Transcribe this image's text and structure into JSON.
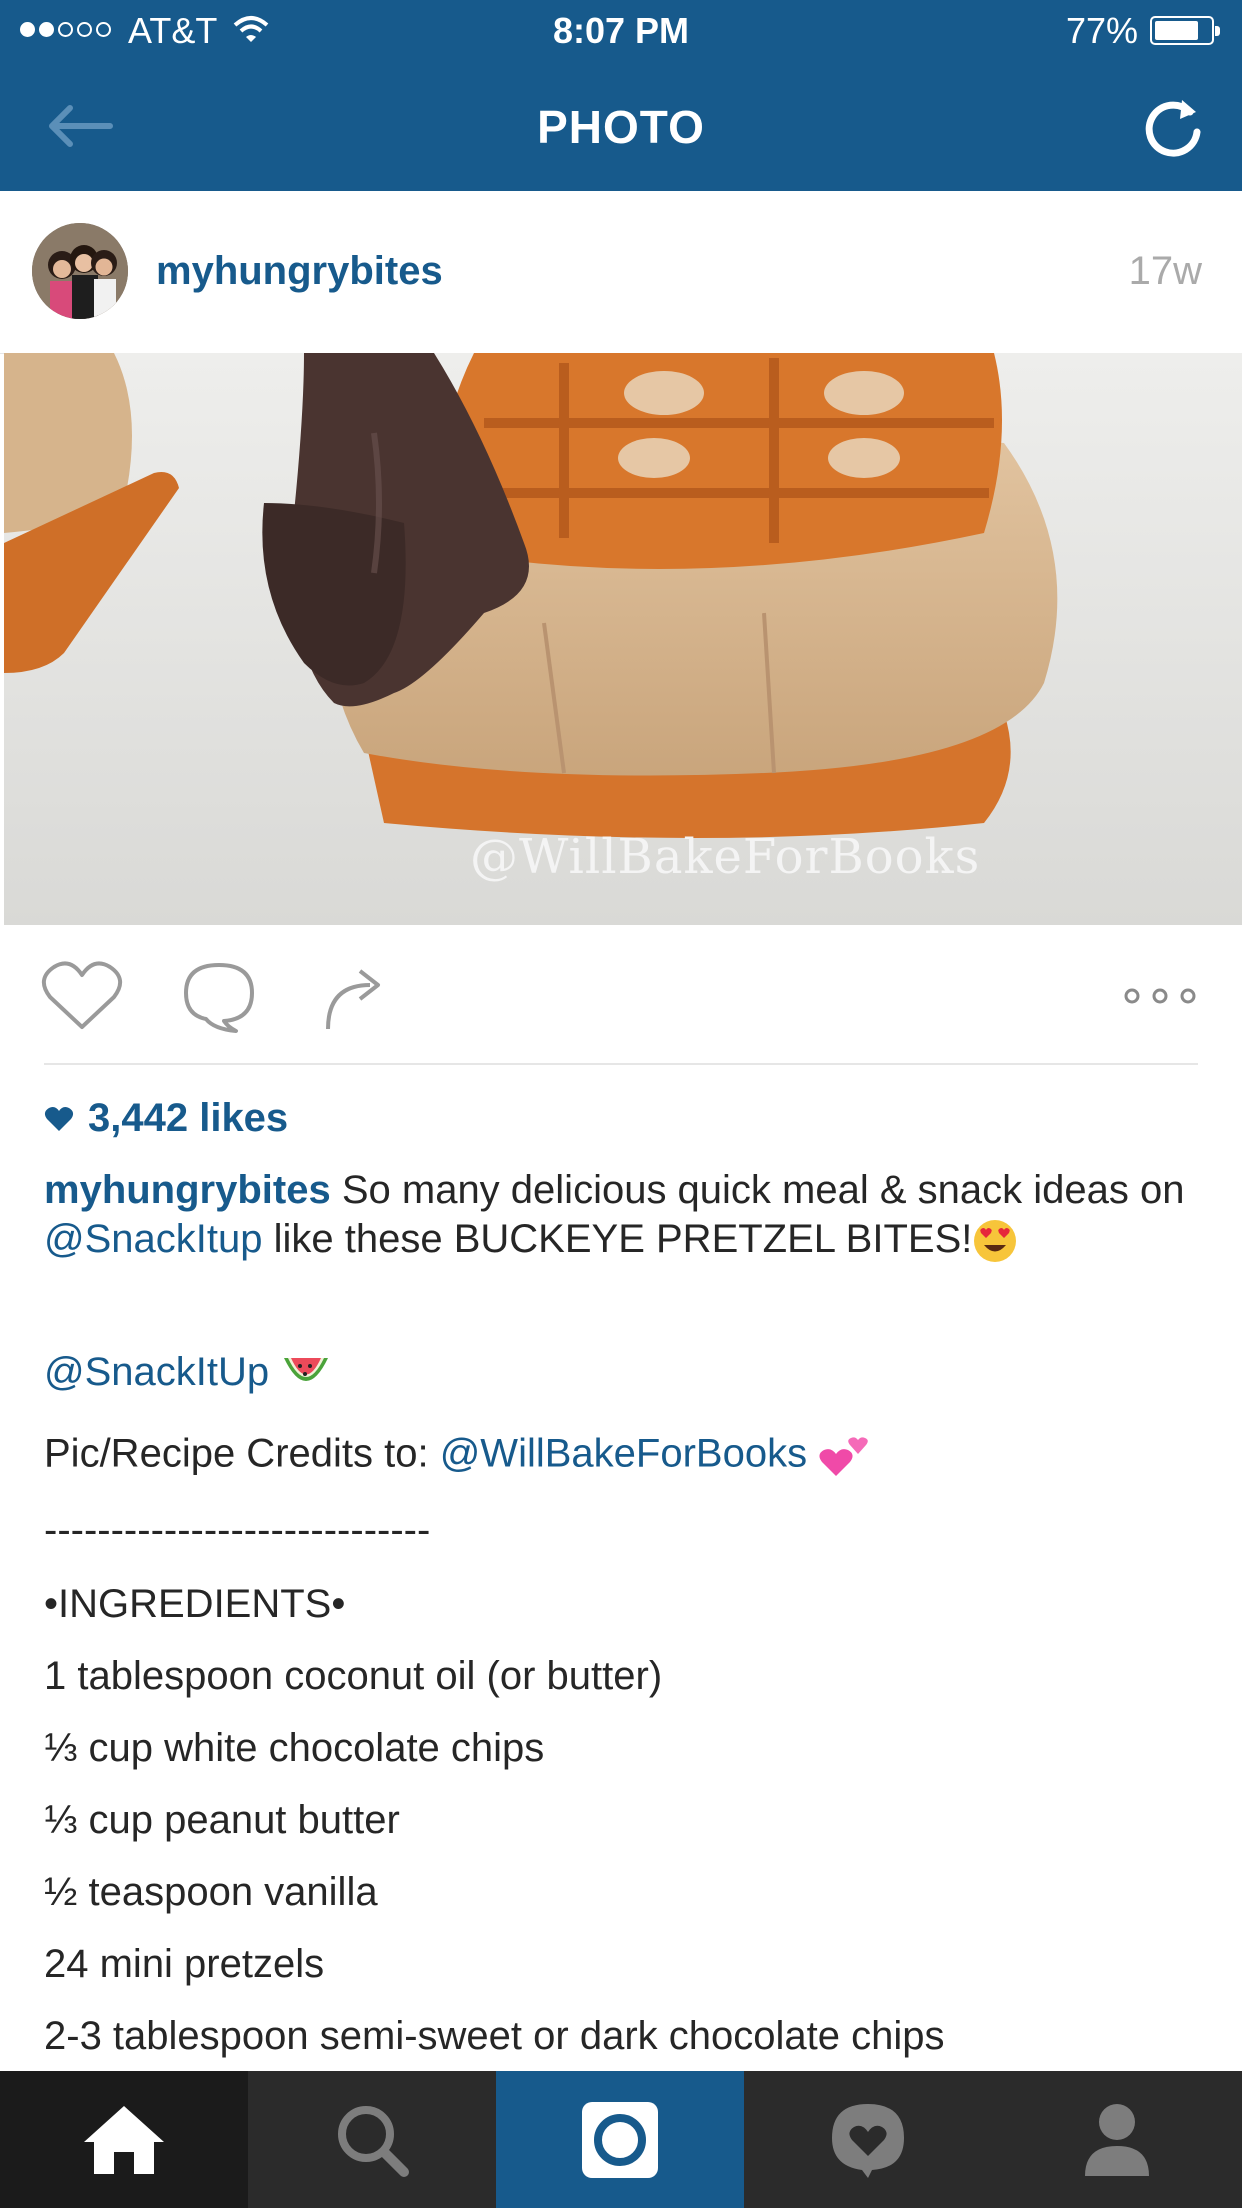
{
  "status_bar": {
    "carrier": "AT&T",
    "time": "8:07 PM",
    "battery": "77%",
    "battery_level": 0.77,
    "signal_bars": 2
  },
  "nav": {
    "title": "PHOTO",
    "back_icon": "back-arrow-icon",
    "refresh_icon": "refresh-icon"
  },
  "post": {
    "username": "myhungrybites",
    "age": "17w",
    "watermark": "@WillBakeForBooks",
    "likes": "3,442 likes"
  },
  "caption": {
    "username": "myhungrybites",
    "text1": " So many delicious quick meal & snack ideas on ",
    "mention1": "@SnackItup",
    "text2": " like these BUCKEYE PRETZEL BITES!",
    "mention2": "@SnackItUp",
    "credits_label": "Pic/Recipe Credits to: ",
    "credits_mention": "@WillBakeForBooks",
    "separator": "-----------------------------",
    "heading": "•INGREDIENTS•",
    "ingredients": [
      "1 tablespoon coconut oil (or butter)",
      "⅓ cup white chocolate chips",
      "⅓ cup peanut butter",
      "½ teaspoon vanilla",
      "24 mini pretzels",
      "2-3 tablespoon semi-sweet or dark chocolate chips"
    ]
  },
  "tabs": [
    "home",
    "search",
    "camera",
    "activity",
    "profile"
  ],
  "colors": {
    "brand": "#175a8c",
    "tabbar": "#222222",
    "text": "#262626"
  }
}
